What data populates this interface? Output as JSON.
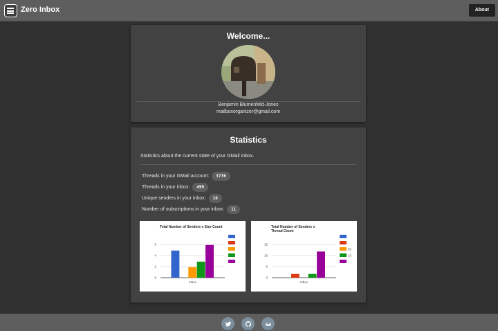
{
  "header": {
    "title": "Zero Inbox",
    "menu_icon": "hamburger-menu-icon",
    "about_label": "About"
  },
  "welcome": {
    "title": "Welcome...",
    "name": "Benjamin Blumenfeld-Jones",
    "email": "mailboxorganizer@gmail.com"
  },
  "stats": {
    "title": "Statistics",
    "description": "Statistics about the current state of your GMail inbox.",
    "items": [
      {
        "label": "Threads in your GMail account:",
        "value": "3776"
      },
      {
        "label": "Threads in your inbox:",
        "value": "499"
      },
      {
        "label": "Unique senders in your inbox:",
        "value": "16"
      },
      {
        "label": "Number of subscriptions in your inbox:",
        "value": "11"
      }
    ]
  },
  "chart_data": [
    {
      "type": "bar",
      "title": "Total Number of Senders x Size Count",
      "categories": [
        "Inbox"
      ],
      "xlabel": "Inbox",
      "ylim": [
        0,
        8
      ],
      "yticks": [
        "0",
        "2",
        "4",
        "6"
      ],
      "series": [
        {
          "name": "",
          "values": [
            4.9
          ],
          "color": "#3366cc"
        },
        {
          "name": "",
          "values": [
            0
          ],
          "color": "#dc3912"
        },
        {
          "name": "",
          "values": [
            1.9
          ],
          "color": "#ff9900"
        },
        {
          "name": "",
          "values": [
            2.9
          ],
          "color": "#109618"
        },
        {
          "name": "...",
          "values": [
            5.9
          ],
          "color": "#990099"
        }
      ]
    },
    {
      "type": "bar",
      "title": "Total Number of Senders x Thread Count",
      "categories": [
        "Inbox"
      ],
      "xlabel": "Inbox",
      "ylim": [
        0,
        20
      ],
      "yticks": [
        "0",
        "5",
        "10",
        "15"
      ],
      "series": [
        {
          "name": "",
          "values": [
            0
          ],
          "color": "#3366cc"
        },
        {
          "name": "",
          "values": [
            1.7
          ],
          "color": "#dc3912"
        },
        {
          "name": "50",
          "values": [
            0
          ],
          "color": "#ff9900"
        },
        {
          "name": "15",
          "values": [
            1.7
          ],
          "color": "#109618"
        },
        {
          "name": "...",
          "values": [
            11.8
          ],
          "color": "#990099"
        }
      ]
    }
  ],
  "footer": {
    "icons": [
      "twitter-icon",
      "github-icon",
      "email-icon"
    ]
  }
}
